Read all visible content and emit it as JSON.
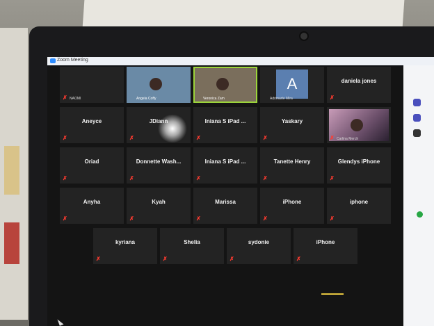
{
  "window": {
    "title": "Zoom Meeting"
  },
  "rows": [
    [
      {
        "id": "t1",
        "name": "",
        "label": "NAOMI",
        "muted": true,
        "video": false
      },
      {
        "id": "t2",
        "name": "",
        "label": "Angela Coffy",
        "muted": false,
        "video": true
      },
      {
        "id": "t3",
        "name": "",
        "label": "Veronica Zam",
        "muted": false,
        "video": true,
        "speaking": true
      },
      {
        "id": "t4",
        "name": "",
        "label": "Adrimarte Mira",
        "muted": false,
        "avatar": "A"
      },
      {
        "id": "t5",
        "name": "daniela jones",
        "label": "",
        "muted": true,
        "video": false
      }
    ],
    [
      {
        "id": "t6",
        "name": "Aneyce",
        "muted": true
      },
      {
        "id": "t7",
        "name": "JDiann",
        "muted": true
      },
      {
        "id": "t8",
        "name": "Iniana S iPad ...",
        "muted": true
      },
      {
        "id": "t9",
        "name": "Yaskary",
        "muted": true
      },
      {
        "id": "t10",
        "name": "",
        "label": "Carlina Merch",
        "muted": true,
        "photo": true
      }
    ],
    [
      {
        "id": "t11",
        "name": "Oriad",
        "muted": true
      },
      {
        "id": "t12",
        "name": "Donnette Wash...",
        "muted": true
      },
      {
        "id": "t13",
        "name": "Iniana S iPad ...",
        "muted": true
      },
      {
        "id": "t14",
        "name": "Tanette Henry",
        "muted": true
      },
      {
        "id": "t15",
        "name": "Glendys iPhone",
        "muted": true
      }
    ],
    [
      {
        "id": "t16",
        "name": "Anyha",
        "muted": true
      },
      {
        "id": "t17",
        "name": "Kyah",
        "muted": true
      },
      {
        "id": "t18",
        "name": "Marissa",
        "muted": true
      },
      {
        "id": "t19",
        "name": "iPhone",
        "muted": true
      },
      {
        "id": "t20",
        "name": "iphone",
        "muted": true
      }
    ],
    [
      {
        "id": "t21",
        "name": "kyriana",
        "muted": true
      },
      {
        "id": "t22",
        "name": "Shelia",
        "muted": true
      },
      {
        "id": "t23",
        "name": "sydonie",
        "muted": true
      },
      {
        "id": "t24",
        "name": "iPhone",
        "muted": true
      }
    ]
  ],
  "colors": {
    "muted": "#ff3b30",
    "speaking": "#9bd43a",
    "avatar": "#5b7fb0"
  }
}
